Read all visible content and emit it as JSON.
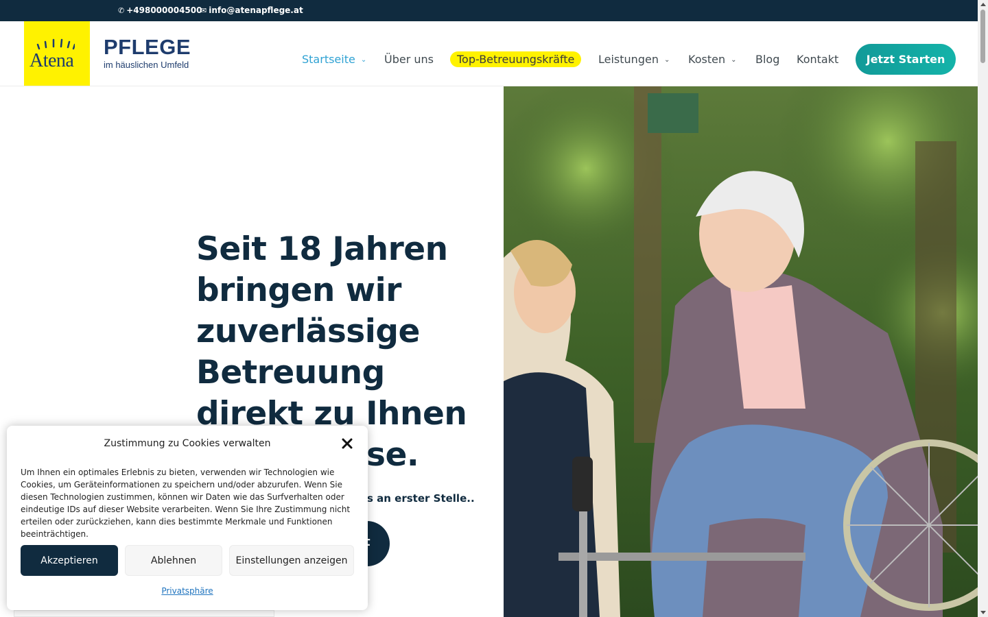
{
  "topbar": {
    "phone": "+498000004500",
    "email": "info@atenapflege.at"
  },
  "brand": {
    "logo_word": "Atena",
    "title": "PFLEGE",
    "subtitle": "im häuslichen Umfeld"
  },
  "nav": {
    "items": [
      {
        "label": "Startseite",
        "dropdown": true,
        "active": true
      },
      {
        "label": "Über uns",
        "dropdown": false
      },
      {
        "label": "Top-Betreuungskräfte",
        "dropdown": false,
        "highlight": true
      },
      {
        "label": "Leistungen",
        "dropdown": true
      },
      {
        "label": "Kosten",
        "dropdown": true
      },
      {
        "label": "Blog",
        "dropdown": false
      },
      {
        "label": "Kontakt",
        "dropdown": false
      }
    ],
    "cta": "Jetzt Starten"
  },
  "hero": {
    "headline_lines": [
      "Seit 18 Jahren",
      "bringen wir",
      "zuverlässige",
      "Betreuung",
      "direkt zu Ihnen",
      "se."
    ],
    "subline": "s an erster Stelle..",
    "button_label": "t"
  },
  "cookie": {
    "title": "Zustimmung zu Cookies verwalten",
    "text": "Um Ihnen ein optimales Erlebnis zu bieten, verwenden wir Technologien wie Cookies, um Geräteinformationen zu speichern und/oder abzurufen. Wenn Sie diesen Technologien zustimmen, können wir Daten wie das Surfverhalten oder eindeutige IDs auf dieser Website verarbeiten. Wenn Sie Ihre Zustimmung nicht erteilen oder zurückziehen, kann dies bestimmte Merkmale und Funktionen beeinträchtigen.",
    "accept": "Akzeptieren",
    "deny": "Ablehnen",
    "settings": "Einstellungen anzeigen",
    "privacy": "Privatsphäre"
  },
  "colors": {
    "navy": "#102b3f",
    "accent_blue": "#2fa2d3",
    "teal": "#14b3a9",
    "logo_yellow": "#fff200"
  },
  "icons": {
    "phone": "phone-icon",
    "email": "envelope-icon",
    "close": "close-icon",
    "chevron": "chevron-down-icon"
  }
}
